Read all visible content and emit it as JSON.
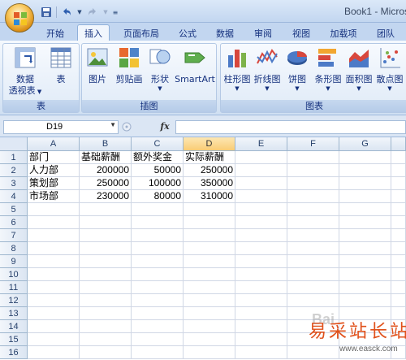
{
  "window": {
    "title": "Book1 - Micros"
  },
  "quick_access": {
    "save_icon": "save-icon",
    "undo_icon": "undo-icon",
    "redo_icon": "redo-icon",
    "customize_icon": "customize-icon"
  },
  "tabs": [
    {
      "label": "开始"
    },
    {
      "label": "插入",
      "active": true
    },
    {
      "label": "页面布局"
    },
    {
      "label": "公式"
    },
    {
      "label": "数据"
    },
    {
      "label": "审阅"
    },
    {
      "label": "视图"
    },
    {
      "label": "加载项"
    },
    {
      "label": "团队"
    }
  ],
  "ribbon": {
    "groups": {
      "table": {
        "label": "表",
        "buttons": {
          "pivot_line1": "数据",
          "pivot_line2": "透视表",
          "table": "表"
        }
      },
      "illustrations": {
        "label": "插图",
        "buttons": {
          "picture": "图片",
          "clipart": "剪贴画",
          "shapes": "形状",
          "smartart": "SmartArt"
        }
      },
      "charts": {
        "label": "图表",
        "buttons": {
          "column": "柱形图",
          "line": "折线图",
          "pie": "饼图",
          "bar": "条形图",
          "area": "面积图",
          "scatter": "散点图"
        }
      }
    }
  },
  "formula_bar": {
    "name_box": "D19",
    "formula": "",
    "fx_label": "fx"
  },
  "grid": {
    "columns": [
      "A",
      "B",
      "C",
      "D",
      "E",
      "F",
      "G"
    ],
    "selected_column": "D",
    "rows": [
      "1",
      "2",
      "3",
      "4",
      "5",
      "6",
      "7",
      "8",
      "9",
      "10",
      "11",
      "12",
      "13",
      "14",
      "15",
      "16"
    ],
    "cells": {
      "headers": [
        "部门",
        "基础薪酬",
        "额外奖金",
        "实际薪酬"
      ],
      "data": [
        [
          "人力部",
          "200000",
          "50000",
          "250000"
        ],
        [
          "策划部",
          "250000",
          "100000",
          "350000"
        ],
        [
          "市场部",
          "230000",
          "80000",
          "310000"
        ]
      ]
    }
  },
  "watermark": {
    "baidu": "Bai",
    "site": "易采站长站",
    "url": "www.easck.com"
  },
  "colors": {
    "accent": "#15317e",
    "selected_header": "#f9cc74",
    "ribbon": "#dce8f6"
  }
}
